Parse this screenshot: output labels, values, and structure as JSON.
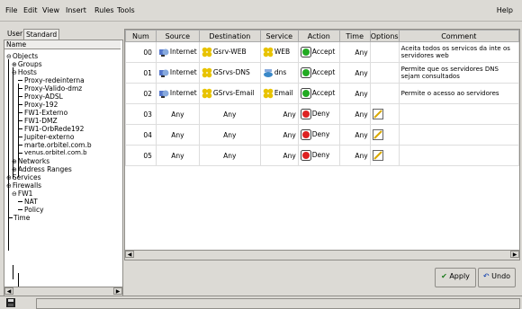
{
  "menubar": {
    "items": [
      "File",
      "Edit",
      "View",
      "Insert",
      "Rules",
      "Tools"
    ],
    "help": "Help"
  },
  "left": {
    "tabs": [
      "User",
      "Standard"
    ],
    "header": "Name",
    "tree": [
      "Objects",
      "Groups",
      "Hosts",
      "Proxy-redeinterna",
      "Proxy-Valido-dmz",
      "Proxy-ADSL",
      "Proxy-192",
      "FW1-Externo",
      "FW1-DMZ",
      "FW1-OrbRede192",
      "Jupiter-externo",
      "marte.orbitel.com.b",
      "venus.orbitel.com.b",
      "Networks",
      "Address Ranges",
      "Services",
      "Firewalls",
      "FW1",
      "NAT",
      "Policy",
      "Time"
    ]
  },
  "table": {
    "headers": [
      "Num",
      "Source",
      "Destination",
      "Service",
      "Action",
      "Time",
      "Options",
      "Comment"
    ],
    "rows": [
      {
        "num": "00",
        "src": "Internet",
        "dst": "Gsrv-WEB",
        "svc": "WEB",
        "act": "Accept",
        "time": "Any",
        "comment": "Aceita todos os servicos da inte os servidores web"
      },
      {
        "num": "01",
        "src": "Internet",
        "dst": "GSrvs-DNS",
        "svc": "dns",
        "act": "Accept",
        "time": "Any",
        "comment": "Permite que os servidores DNS sejam consultados"
      },
      {
        "num": "02",
        "src": "Internet",
        "dst": "GSrvs-Email",
        "svc": "Email",
        "act": "Accept",
        "time": "Any",
        "comment": "Permite o acesso ao servidores"
      },
      {
        "num": "03",
        "src": "Any",
        "dst": "Any",
        "svc": "Any",
        "act": "Deny",
        "time": "Any",
        "comment": ""
      },
      {
        "num": "04",
        "src": "Any",
        "dst": "Any",
        "svc": "Any",
        "act": "Deny",
        "time": "Any",
        "comment": ""
      },
      {
        "num": "05",
        "src": "Any",
        "dst": "Any",
        "svc": "Any",
        "act": "Deny",
        "time": "Any",
        "comment": ""
      }
    ]
  },
  "buttons": {
    "apply": "Apply",
    "undo": "Undo"
  },
  "colors": {
    "accept": "#22aa22",
    "deny": "#dd2222",
    "group": "#e8c300",
    "panel": "#dcdad5"
  }
}
